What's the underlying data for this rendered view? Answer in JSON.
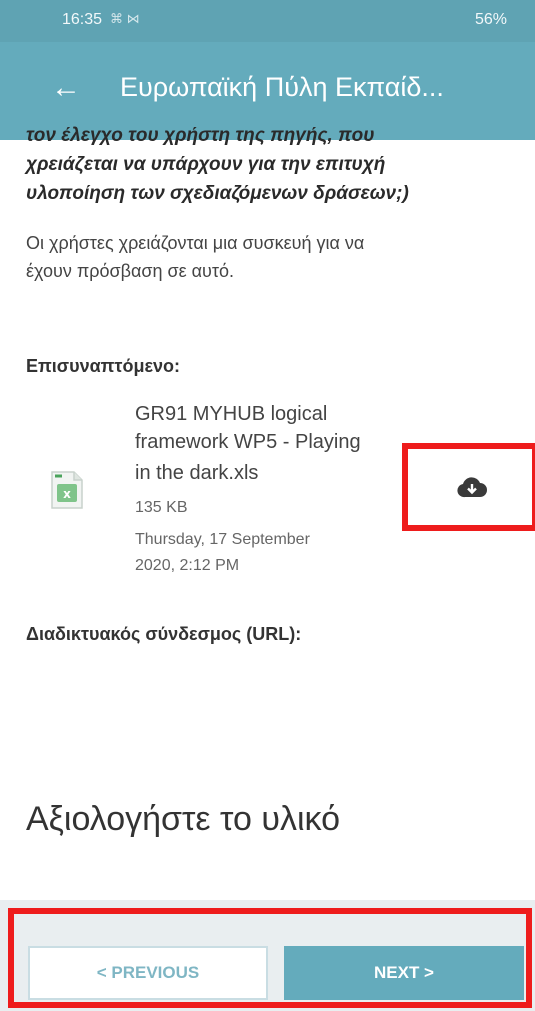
{
  "status_bar": {
    "time": "16:35",
    "notifications": "⌘ ⋈",
    "right": "56%"
  },
  "header": {
    "back_icon": "arrow-left-icon",
    "title": "Ευρωπαϊκή Πύλη Εκπαίδ..."
  },
  "content": {
    "question_line1": "τον έλεγχο του χρήστη της πηγής, που",
    "question_line2": "χρειάζεται να υπάρχουν για την επιτυχή",
    "question_line3": "υλοποίηση των σχεδιαζόμενων δράσεων;)",
    "paragraph_line1": "Οι χρήστες χρειάζονται μια συσκευή για να",
    "paragraph_line2": "έχουν πρόσβαση σε αυτό.",
    "attachment_label": "Επισυναπτόμενο:",
    "attachment": {
      "name_line1": "GR91 MYHUB logical",
      "name_line2": "framework WP5 - Playing",
      "name_line3": "in the dark.xls",
      "size": "135 KB",
      "date_line1": "Thursday, 17 September",
      "date_line2": "2020, 2:12 PM",
      "file_icon": "excel-file-icon",
      "download_icon": "cloud-download-icon"
    },
    "url_label": "Διαδικτυακός σύνδεσμος (URL):",
    "rate_heading": "Αξιολογήστε το υλικό"
  },
  "navigation": {
    "previous_label": "< PREVIOUS",
    "next_label": "NEXT >"
  },
  "colors": {
    "primary": "#64abbc",
    "highlight": "#ee1c1c"
  }
}
